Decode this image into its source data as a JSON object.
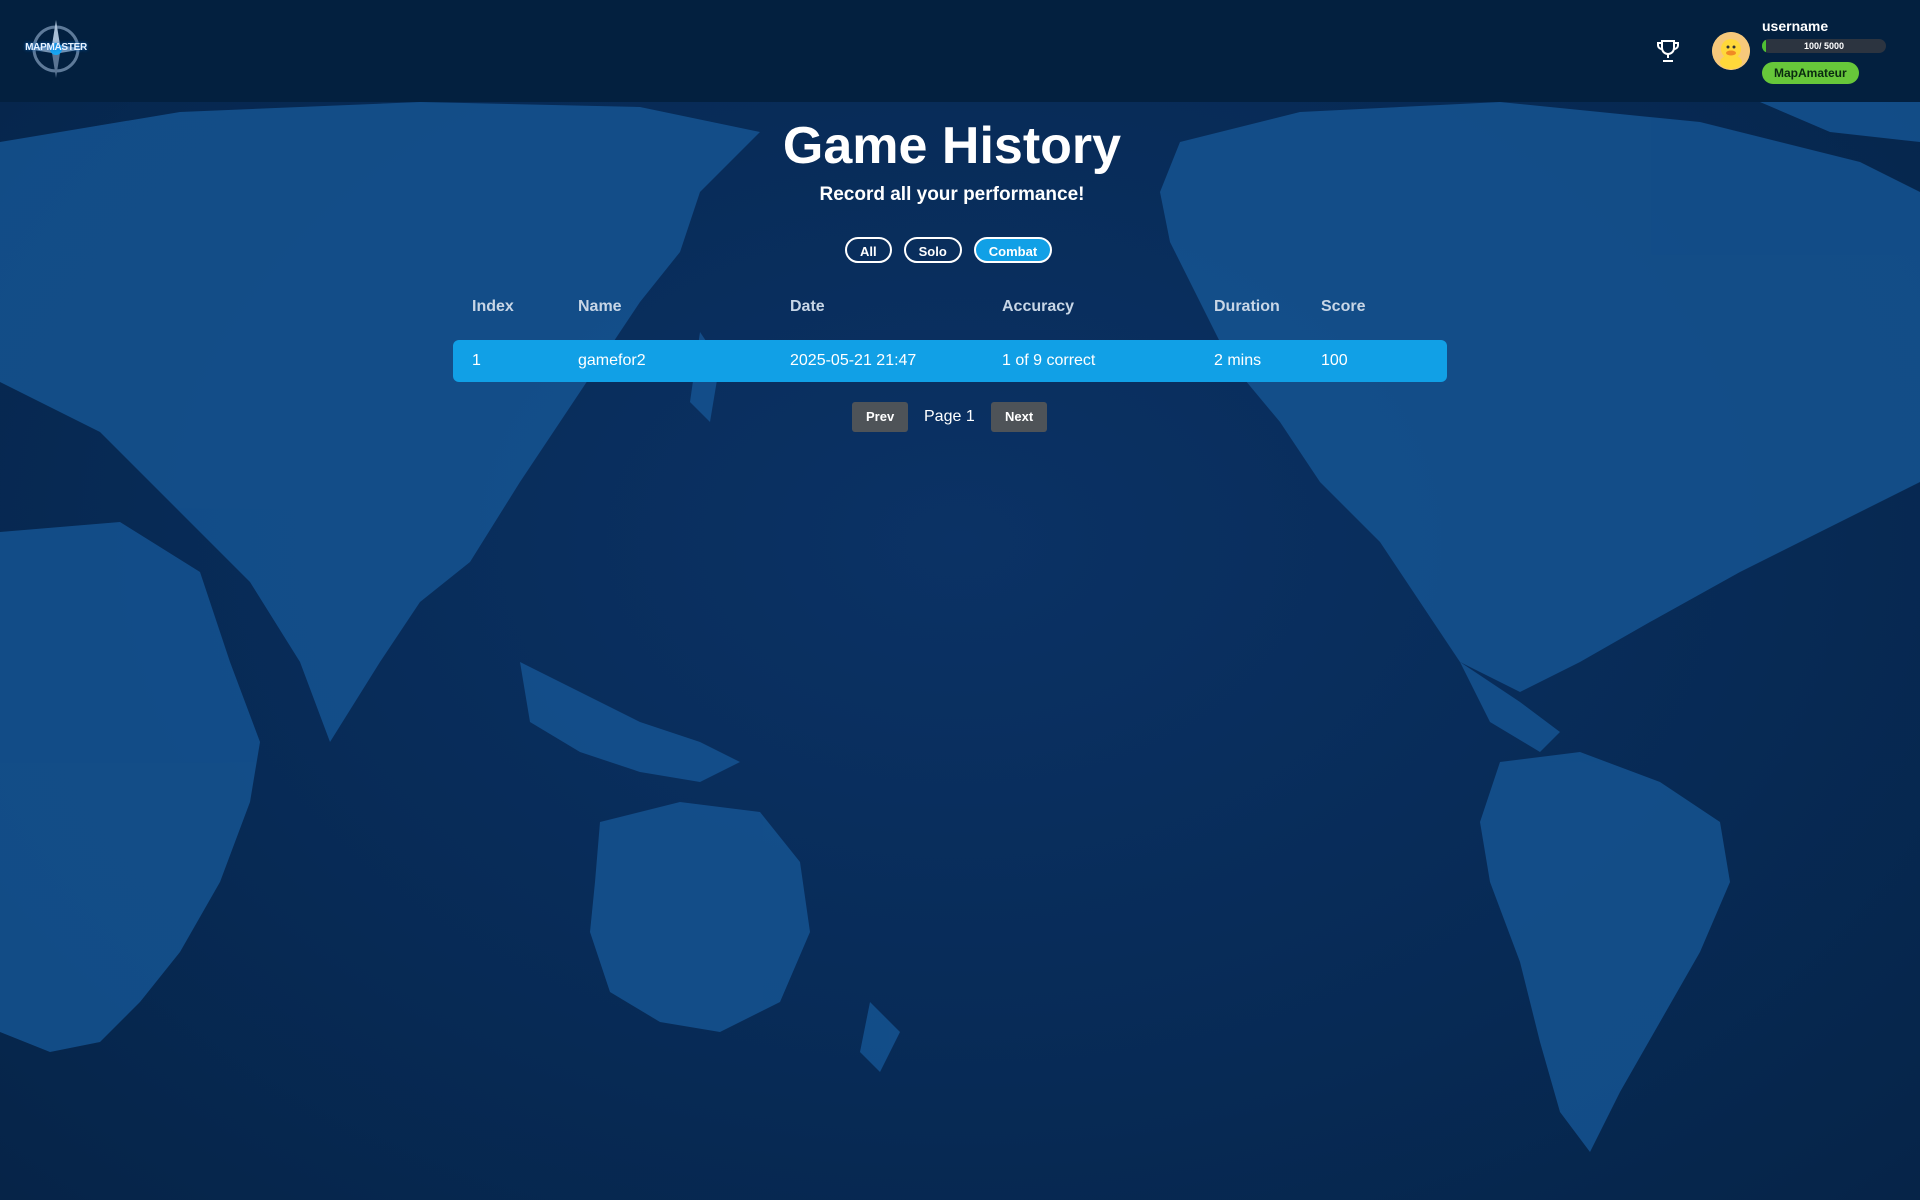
{
  "header": {
    "logo_text": "MAPMASTER",
    "trophy_icon": "trophy-icon",
    "user": {
      "name": "username",
      "xp_text": "100/ 5000",
      "xp_current": 100,
      "xp_max": 5000,
      "rank": "MapAmateur",
      "avatar_icon": "duck-avatar-icon"
    }
  },
  "main": {
    "title": "Game History",
    "subtitle": "Record all your performance!",
    "filters": [
      {
        "label": "All",
        "active": false
      },
      {
        "label": "Solo",
        "active": false
      },
      {
        "label": "Combat",
        "active": true
      }
    ],
    "table": {
      "columns": [
        "Index",
        "Name",
        "Date",
        "Accuracy",
        "Duration",
        "Score"
      ],
      "rows": [
        [
          "1",
          "gamefor2",
          "2025-05-21 21:47",
          "1 of 9 correct",
          "2 mins",
          "100"
        ]
      ]
    },
    "pagination": {
      "prev_label": "Prev",
      "page_label": "Page 1",
      "next_label": "Next"
    }
  },
  "colors": {
    "accent": "#11a0e6",
    "header_bg": "#03203f",
    "page_bg": "#07264f",
    "rank_badge": "#67c73a",
    "xp_fill": "#4fc034"
  }
}
